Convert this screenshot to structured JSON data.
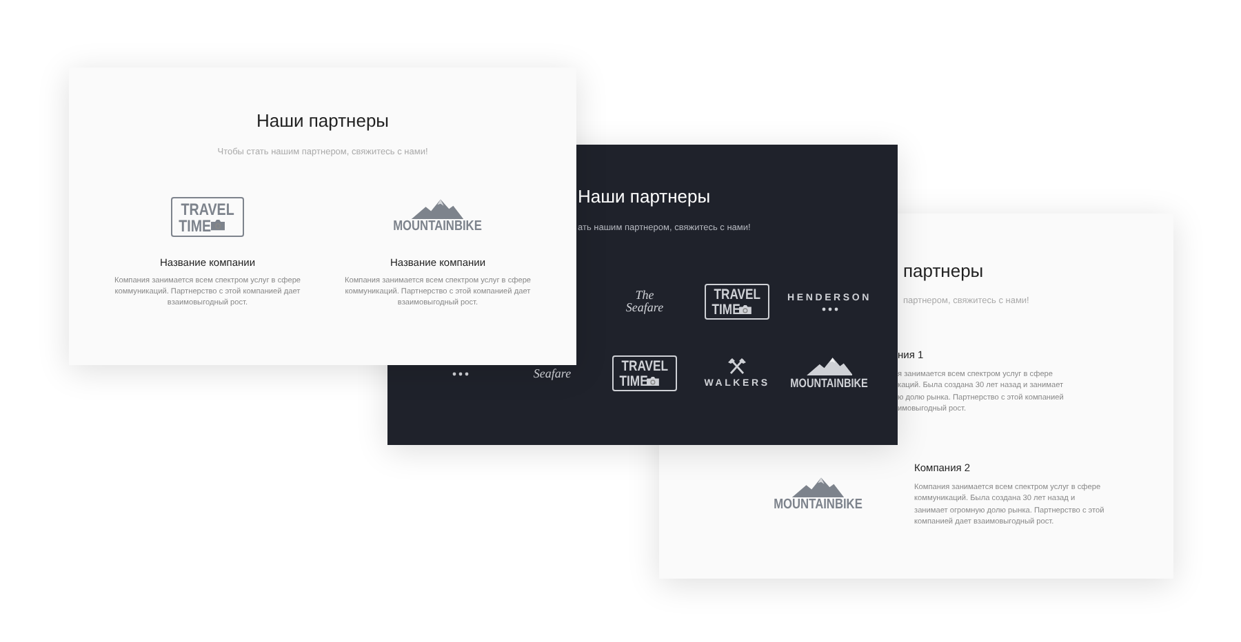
{
  "cards": [
    {
      "kind": "columns",
      "title": "Наши партнеры",
      "subtitle": "Чтобы стать нашим партнером, свяжитесь с нами!",
      "partners": [
        {
          "logo": {
            "kind": "travel",
            "lines": [
              "TRAVEL",
              "TIME"
            ]
          },
          "name": "Название компании",
          "description": "Компания занимается всем спектром услуг в сфере коммуникаций. Партнерство с этой компанией дает взаимовыгодный рост."
        },
        {
          "logo": {
            "kind": "mountain",
            "lines": [
              "MOUNTAINBIKE"
            ]
          },
          "name": "Название компании",
          "description": "Компания занимается всем спектром услуг в сфере коммуникаций. Партнерство с этой компанией дает взаимовыгодный рост."
        }
      ]
    },
    {
      "kind": "grid",
      "title": "Наши партнеры",
      "subtitle": "ать нашим партнером, свяжитесь с нами!",
      "rows": [
        [
          "",
          "",
          {
            "kind": "seafare",
            "lines": [
              "The",
              "Seafare"
            ]
          },
          {
            "kind": "travel",
            "lines": [
              "TRAVEL",
              "TIME"
            ]
          },
          {
            "kind": "henderson",
            "lines": [
              "HENDERSON"
            ]
          }
        ],
        [
          {
            "kind": "dots"
          },
          {
            "kind": "seafare",
            "lines": [
              "Seafare"
            ]
          },
          {
            "kind": "travel",
            "lines": [
              "TRAVEL",
              "TIME"
            ]
          },
          {
            "kind": "walkers",
            "lines": [
              "WALKERS"
            ]
          },
          {
            "kind": "mountain",
            "lines": [
              "MOUNTAINBIKE"
            ]
          }
        ]
      ]
    },
    {
      "kind": "list",
      "title": "партнеры",
      "subtitle": "партнером, свяжитесь с нами!",
      "partners": [
        {
          "name": "ния 1",
          "description_lines": [
            "я занимается всем спектром услуг в сфере",
            "каций. Была создана 30 лет назад и занимает",
            "ю долю рынка. Партнерство с этой компанией",
            "имовыгодный рост."
          ]
        },
        {
          "logo": {
            "kind": "mountain",
            "lines": [
              "MOUNTAINBIKE"
            ]
          },
          "name": "Компания 2",
          "description": "Компания занимается всем спектром услуг в сфере коммуникаций. Была создана 30 лет назад и занимает огромную долю рынка. Партнерство с этой компанией дает взаимовыгодный рост."
        }
      ]
    }
  ]
}
